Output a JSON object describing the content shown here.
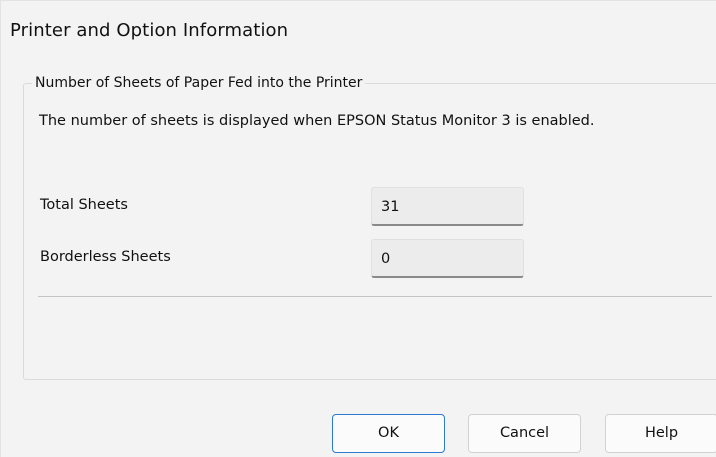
{
  "window": {
    "title": "Printer and Option Information"
  },
  "group": {
    "legend": "Number of Sheets of Paper Fed into the Printer",
    "description": "The number of sheets is displayed when EPSON Status Monitor 3 is enabled.",
    "total_sheets": {
      "label": "Total Sheets",
      "value": "31"
    },
    "borderless_sheets": {
      "label": "Borderless Sheets",
      "value": "0"
    }
  },
  "buttons": {
    "ok": "OK",
    "cancel": "Cancel",
    "help": "Help"
  },
  "colors": {
    "dialog_background": "#f3f3f3",
    "field_background": "#ececec",
    "ok_focus_border": "#2a7bd1"
  }
}
